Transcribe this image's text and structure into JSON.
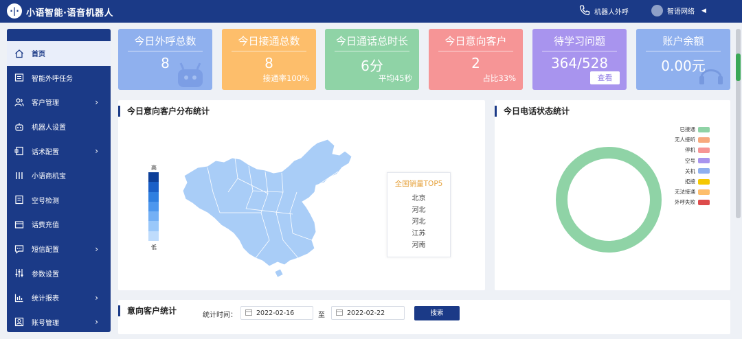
{
  "app": {
    "title": "小语智能·语音机器人",
    "logo_glyph": "·|·"
  },
  "topbar": {
    "robot_call_label": "机器人外呼",
    "user_name": "智语网络",
    "icons": [
      "phone-icon",
      "avatar",
      "caret-left-icon"
    ]
  },
  "sidebar": {
    "items": [
      {
        "label": "首页",
        "icon": "home-icon",
        "has_arrow": false,
        "active": true
      },
      {
        "label": "智能外呼任务",
        "icon": "task-icon",
        "has_arrow": false,
        "active": false
      },
      {
        "label": "客户管理",
        "icon": "users-icon",
        "has_arrow": true,
        "active": false
      },
      {
        "label": "机器人设置",
        "icon": "robot-icon",
        "has_arrow": false,
        "active": false
      },
      {
        "label": "话术配置",
        "icon": "script-icon",
        "has_arrow": true,
        "active": false
      },
      {
        "label": "小语商机宝",
        "icon": "bars-icon",
        "has_arrow": false,
        "active": false
      },
      {
        "label": "空号检测",
        "icon": "detect-icon",
        "has_arrow": false,
        "active": false
      },
      {
        "label": "话费充值",
        "icon": "wallet-icon",
        "has_arrow": false,
        "active": false
      },
      {
        "label": "短信配置",
        "icon": "sms-icon",
        "has_arrow": true,
        "active": false
      },
      {
        "label": "参数设置",
        "icon": "sliders-icon",
        "has_arrow": false,
        "active": false
      },
      {
        "label": "统计报表",
        "icon": "chart-icon",
        "has_arrow": true,
        "active": false
      },
      {
        "label": "账号管理",
        "icon": "account-icon",
        "has_arrow": true,
        "active": false
      }
    ],
    "arrow_glyph": "›"
  },
  "cards": [
    {
      "title": "今日外呼总数",
      "value": "8",
      "sub": "",
      "color": "#8fb0ee",
      "deco": "robot"
    },
    {
      "title": "今日接通总数",
      "value": "8",
      "sub": "接通率100%",
      "color": "#fdbe6b",
      "deco": ""
    },
    {
      "title": "今日通话总时长",
      "value": "6分",
      "sub": "平均45秒",
      "color": "#8fd3a6",
      "deco": ""
    },
    {
      "title": "今日意向客户",
      "value": "2",
      "sub": "占比33%",
      "color": "#f69596",
      "deco": ""
    },
    {
      "title": "待学习问题",
      "value": "364/528",
      "button": "查看",
      "color": "#a894ee",
      "deco": ""
    },
    {
      "title": "账户余额",
      "value": "0.00元",
      "sub": "",
      "color": "#8fb0ee",
      "deco": "headset"
    }
  ],
  "map_panel": {
    "title": "今日意向客户分布统计",
    "legend_high": "高",
    "legend_low": "低",
    "legend_colors": [
      "#0d3f99",
      "#1a5fc7",
      "#2f7fe0",
      "#4d97ee",
      "#74b0f5",
      "#9ac8fa",
      "#bfdcfc"
    ],
    "map_color": "#a9cdf7",
    "top5": {
      "title": "全国销量TOP5",
      "items": [
        "北京",
        "河北",
        "河北",
        "江苏",
        "河南"
      ]
    }
  },
  "status_panel": {
    "title": "今日电话状态统计",
    "legend": [
      {
        "label": "已接通",
        "color": "#8fd3a6"
      },
      {
        "label": "无人接听",
        "color": "#f7a97e"
      },
      {
        "label": "停机",
        "color": "#f69596"
      },
      {
        "label": "空号",
        "color": "#a894ee"
      },
      {
        "label": "关机",
        "color": "#8fb0ee"
      },
      {
        "label": "拒接",
        "color": "#f5c800"
      },
      {
        "label": "无法接通",
        "color": "#fdbe6b"
      },
      {
        "label": "外呼失败",
        "color": "#dd4b4b"
      }
    ],
    "ring_color": "#8fd3a6"
  },
  "chart_data": {
    "type": "pie",
    "title": "今日电话状态统计",
    "categories": [
      "已接通",
      "无人接听",
      "停机",
      "空号",
      "关机",
      "拒接",
      "无法接通",
      "外呼失败"
    ],
    "values": [
      8,
      0,
      0,
      0,
      0,
      0,
      0,
      0
    ],
    "legend_position": "top-right"
  },
  "intent_panel": {
    "title": "意向客户统计",
    "time_label": "统计时间：",
    "start_date": "2022-02-16",
    "to_label": "至",
    "end_date": "2022-02-22",
    "search_label": "搜索"
  }
}
